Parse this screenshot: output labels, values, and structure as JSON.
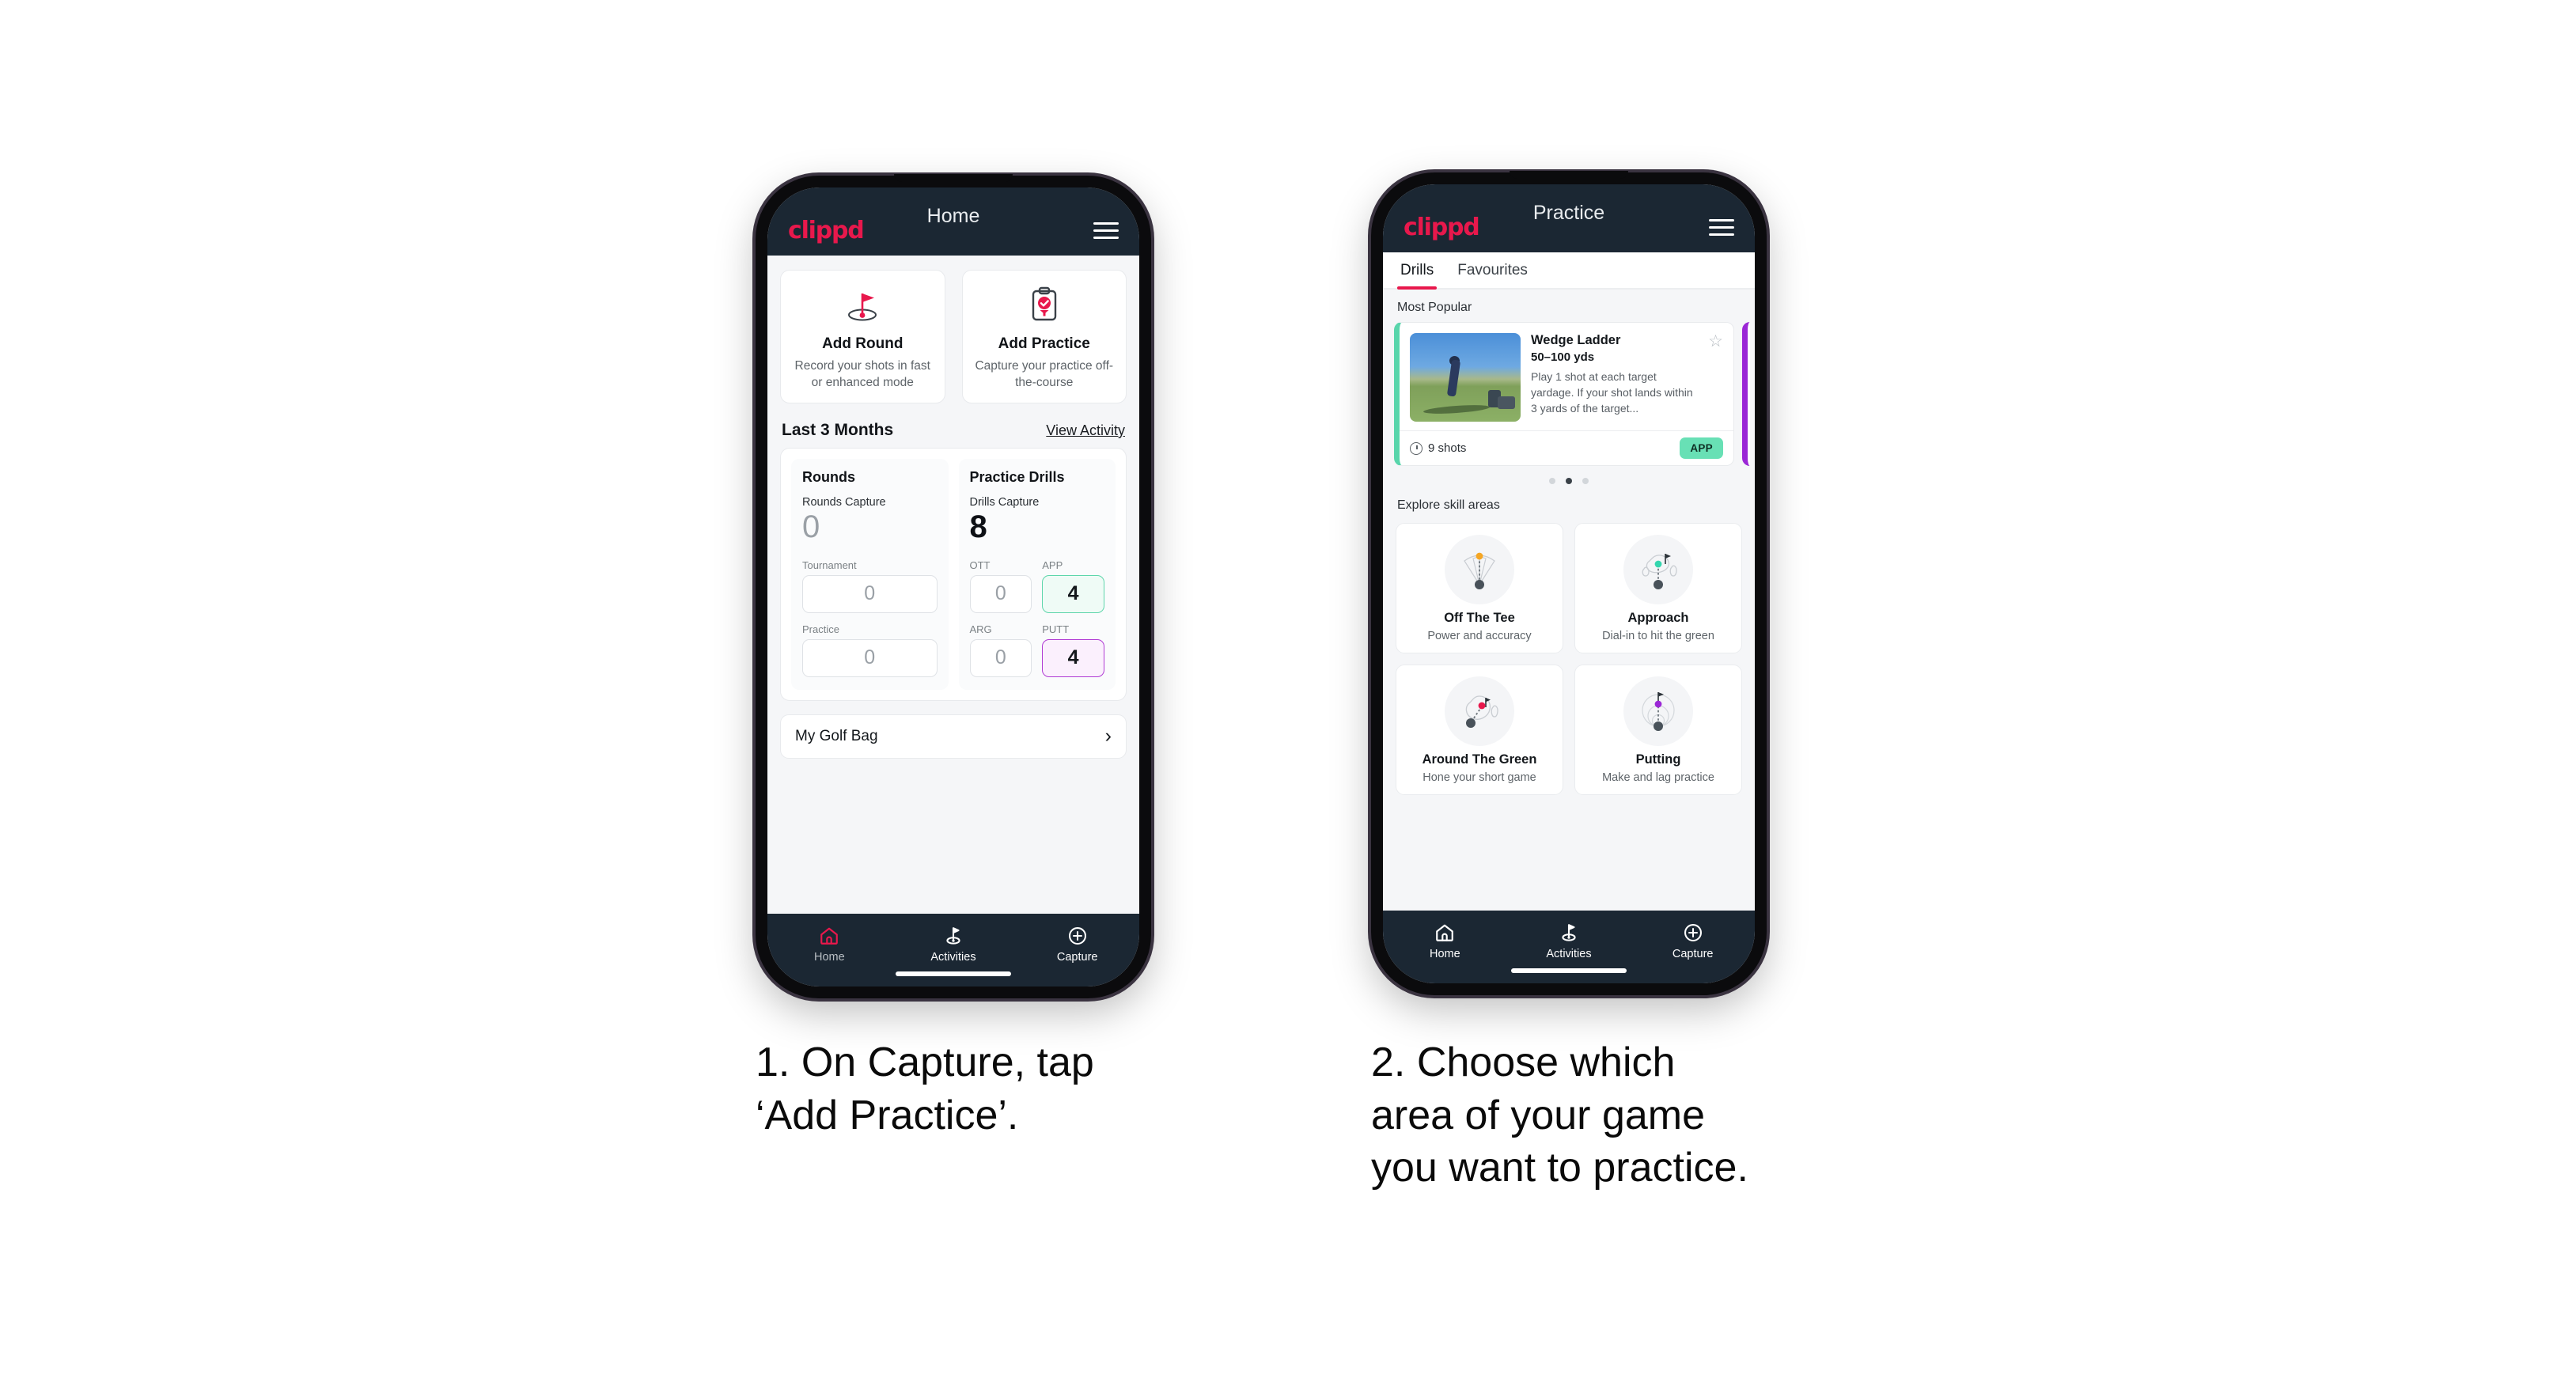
{
  "phone1": {
    "appbar": {
      "logo": "clippd",
      "title": "Home",
      "menu_icon": "hamburger-icon"
    },
    "quick_actions": [
      {
        "icon": "golf-flag-icon",
        "title": "Add Round",
        "subtitle": "Record your shots in fast or enhanced mode"
      },
      {
        "icon": "clipboard-check-icon",
        "title": "Add Practice",
        "subtitle": "Capture your practice off-the-course"
      }
    ],
    "section": {
      "title": "Last 3 Months",
      "link": "View Activity"
    },
    "rounds": {
      "title": "Rounds",
      "capture_label": "Rounds Capture",
      "capture_value": "0",
      "metrics": [
        {
          "label": "Tournament",
          "value": "0",
          "state": "empty"
        },
        {
          "label": "Practice",
          "value": "0",
          "state": "empty"
        }
      ]
    },
    "drills": {
      "title": "Practice Drills",
      "capture_label": "Drills Capture",
      "capture_value": "8",
      "metrics": [
        {
          "label": "OTT",
          "value": "0",
          "state": "empty"
        },
        {
          "label": "APP",
          "value": "4",
          "state": "green"
        },
        {
          "label": "ARG",
          "value": "0",
          "state": "empty"
        },
        {
          "label": "PUTT",
          "value": "4",
          "state": "purple"
        }
      ]
    },
    "golf_bag": {
      "label": "My Golf Bag",
      "chevron": "chevron-right-icon"
    },
    "bottom_nav": [
      {
        "icon": "home-icon",
        "label": "Home",
        "active": true
      },
      {
        "icon": "golf-activity-icon",
        "label": "Activities",
        "active": false
      },
      {
        "icon": "plus-circle-icon",
        "label": "Capture",
        "active": false
      }
    ]
  },
  "phone2": {
    "appbar": {
      "logo": "clippd",
      "title": "Practice",
      "menu_icon": "hamburger-icon"
    },
    "tabs": [
      {
        "label": "Drills",
        "active": true
      },
      {
        "label": "Favourites",
        "active": false
      }
    ],
    "most_popular_label": "Most Popular",
    "drill_card": {
      "title": "Wedge Ladder",
      "yardage": "50–100 yds",
      "description": "Play 1 shot at each target yardage. If your shot lands within 3 yards of the target...",
      "shots": "9 shots",
      "badge": "APP",
      "star_icon": "star-outline-icon",
      "accent_color": "#58d5ab",
      "next_accent_color": "#9b27d6"
    },
    "carousel_dots": {
      "count": 3,
      "active_index": 1
    },
    "explore_label": "Explore skill areas",
    "skill_areas": [
      {
        "icon": "tee-fan-icon",
        "title": "Off The Tee",
        "subtitle": "Power and accuracy",
        "dot_color": "#f5a623"
      },
      {
        "icon": "green-approach-icon",
        "title": "Approach",
        "subtitle": "Dial-in to hit the green",
        "dot_color": "#34d6ae"
      },
      {
        "icon": "chip-green-icon",
        "title": "Around The Green",
        "subtitle": "Hone your short game",
        "dot_color": "#e8184c"
      },
      {
        "icon": "putting-rings-icon",
        "title": "Putting",
        "subtitle": "Make and lag practice",
        "dot_color": "#9b27d6"
      }
    ],
    "bottom_nav": [
      {
        "icon": "home-icon",
        "label": "Home",
        "active": false
      },
      {
        "icon": "golf-activity-icon",
        "label": "Activities",
        "active": false
      },
      {
        "icon": "plus-circle-icon",
        "label": "Capture",
        "active": false
      }
    ]
  },
  "captions": {
    "step1": "1. On Capture, tap\n‘Add Practice’.",
    "step2": "2. Choose which\narea of your game\nyou want to practice."
  },
  "colors": {
    "brand_pink": "#e8184c",
    "header_dark": "#1b2733",
    "accent_green": "#58d5ab",
    "accent_purple": "#9b27d6",
    "page_bg": "#ffffff"
  }
}
